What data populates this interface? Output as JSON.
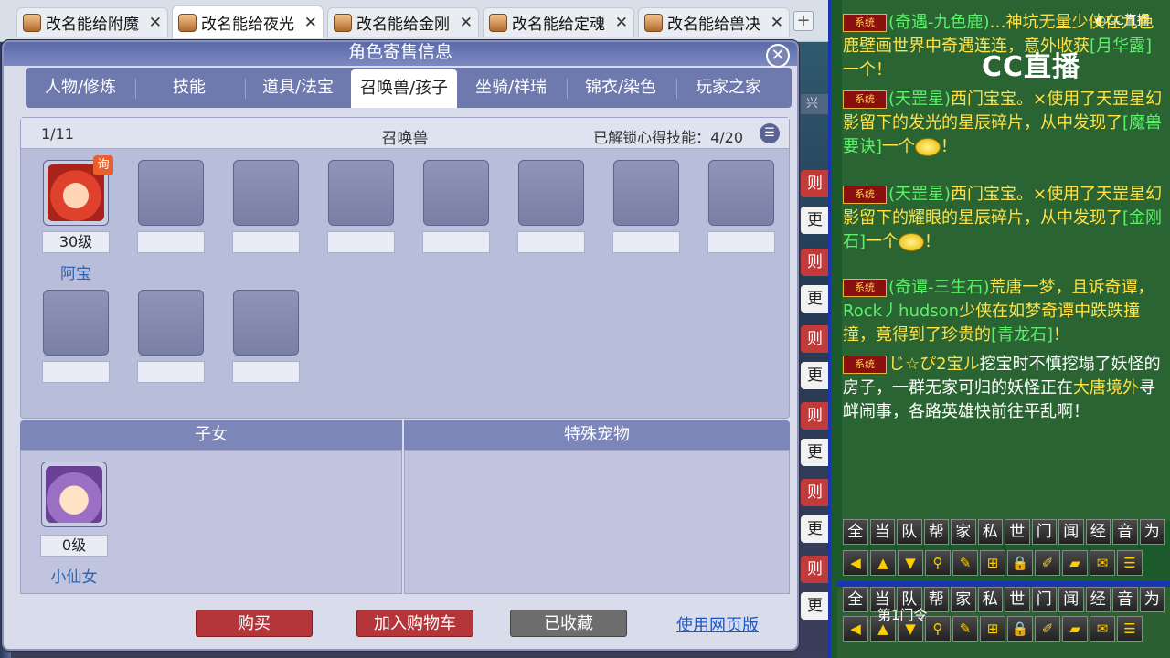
{
  "browser": {
    "tabs": [
      {
        "label": "改名能给附魔",
        "active": false
      },
      {
        "label": "改名能给夜光",
        "active": true
      },
      {
        "label": "改名能给金刚",
        "active": false
      },
      {
        "label": "改名能给定魂",
        "active": false
      },
      {
        "label": "改名能给兽决",
        "active": false
      }
    ],
    "close_glyph": "✕",
    "new_tab_glyph": "+"
  },
  "side_buttons": {
    "top_strip": "兴",
    "items": [
      {
        "label": "则",
        "style": "red"
      },
      {
        "label": "更",
        "style": "white"
      },
      {
        "label": "则",
        "style": "red"
      },
      {
        "label": "更",
        "style": "white"
      },
      {
        "label": "则",
        "style": "red"
      },
      {
        "label": "更",
        "style": "white"
      },
      {
        "label": "则",
        "style": "red"
      },
      {
        "label": "更",
        "style": "white"
      },
      {
        "label": "则",
        "style": "red"
      },
      {
        "label": "更",
        "style": "white"
      },
      {
        "label": "则",
        "style": "red"
      },
      {
        "label": "更",
        "style": "white"
      }
    ]
  },
  "dialog": {
    "title": "角色寄售信息",
    "close_glyph": "✕",
    "tabs": [
      "人物/修炼",
      "技能",
      "道具/法宝",
      "召唤兽/孩子",
      "坐骑/祥瑞",
      "锦衣/染色",
      "玩家之家"
    ],
    "active_tab": 3,
    "summon": {
      "page": "1/11",
      "title": "召唤兽",
      "skill_unlock": "已解锁心得技能：4/20",
      "list_icon": "☰",
      "pet": {
        "level": "30级",
        "name": "阿宝",
        "badge": "询"
      }
    },
    "kids_header": "子女",
    "special_header": "特殊宠物",
    "kid": {
      "level": "0级",
      "name": "小仙女"
    },
    "buttons": {
      "buy": "购买",
      "cart": "加入购物车",
      "saved": "已收藏",
      "web": "使用网页版"
    }
  },
  "chat": {
    "logo": "CC直播",
    "logo_small": "◐CC直播",
    "tag": "系统",
    "messages": [
      {
        "parts": [
          {
            "t": "(奇遇-九色鹿)",
            "c": "g"
          },
          {
            "t": "…神坑无量",
            "c": "y"
          },
          {
            "t": "少侠在九色鹿壁画世界中奇遇连连，意外收获",
            "c": "y"
          },
          {
            "t": "[月华露]",
            "c": "g"
          },
          {
            "t": "一个！",
            "c": "y"
          }
        ]
      },
      {
        "parts": [
          {
            "t": "(天罡星)",
            "c": "g"
          },
          {
            "t": "西门宝宝。",
            "c": "y"
          },
          {
            "t": "×使用了天罡星幻影留下的发光的星辰碎片，从中发现了",
            "c": "y"
          },
          {
            "t": "[魔兽要诀]",
            "c": "g"
          },
          {
            "t": "一个",
            "c": "y"
          }
        ],
        "emoji": true,
        "end": "！"
      },
      {
        "parts": [
          {
            "t": "(天罡星)",
            "c": "g"
          },
          {
            "t": "西门宝宝。",
            "c": "y"
          },
          {
            "t": "×使用了天罡星幻影留下的耀眼的星辰碎片，从中发现了",
            "c": "y"
          },
          {
            "t": "[金刚石]",
            "c": "g"
          },
          {
            "t": "一个",
            "c": "y"
          }
        ],
        "emoji": true,
        "end": "！"
      },
      {
        "parts": [
          {
            "t": "(奇谭-三生石)",
            "c": "g"
          },
          {
            "t": "荒唐一梦，且诉奇谭，",
            "c": "y"
          },
          {
            "t": "Rock丿hudson",
            "c": "g"
          },
          {
            "t": "少侠在如梦奇谭中跌跌撞撞，竟得到了珍贵的",
            "c": "y"
          },
          {
            "t": "[青龙石]",
            "c": "g"
          },
          {
            "t": "！",
            "c": "y"
          }
        ]
      },
      {
        "parts": [
          {
            "t": "じ☆ぴ2宝ル",
            "c": "y"
          },
          {
            "t": "挖宝时不慎挖塌了妖怪的房子，一群无家可归的妖怪正在",
            "c": "w"
          },
          {
            "t": "大唐境外",
            "c": "y"
          },
          {
            "t": "寻衅闹事，各路英雄快前往平乱啊！",
            "c": "w"
          }
        ]
      }
    ],
    "channels": [
      "全",
      "当",
      "队",
      "帮",
      "家",
      "私",
      "世",
      "门",
      "闻",
      "经",
      "音",
      "为"
    ],
    "tools": [
      "◀",
      "▲",
      "▼",
      "⚲",
      "✎",
      "⊞",
      "🔒",
      "✐",
      "▰",
      "✉",
      "☰"
    ],
    "overlay_text": "第1门令"
  }
}
